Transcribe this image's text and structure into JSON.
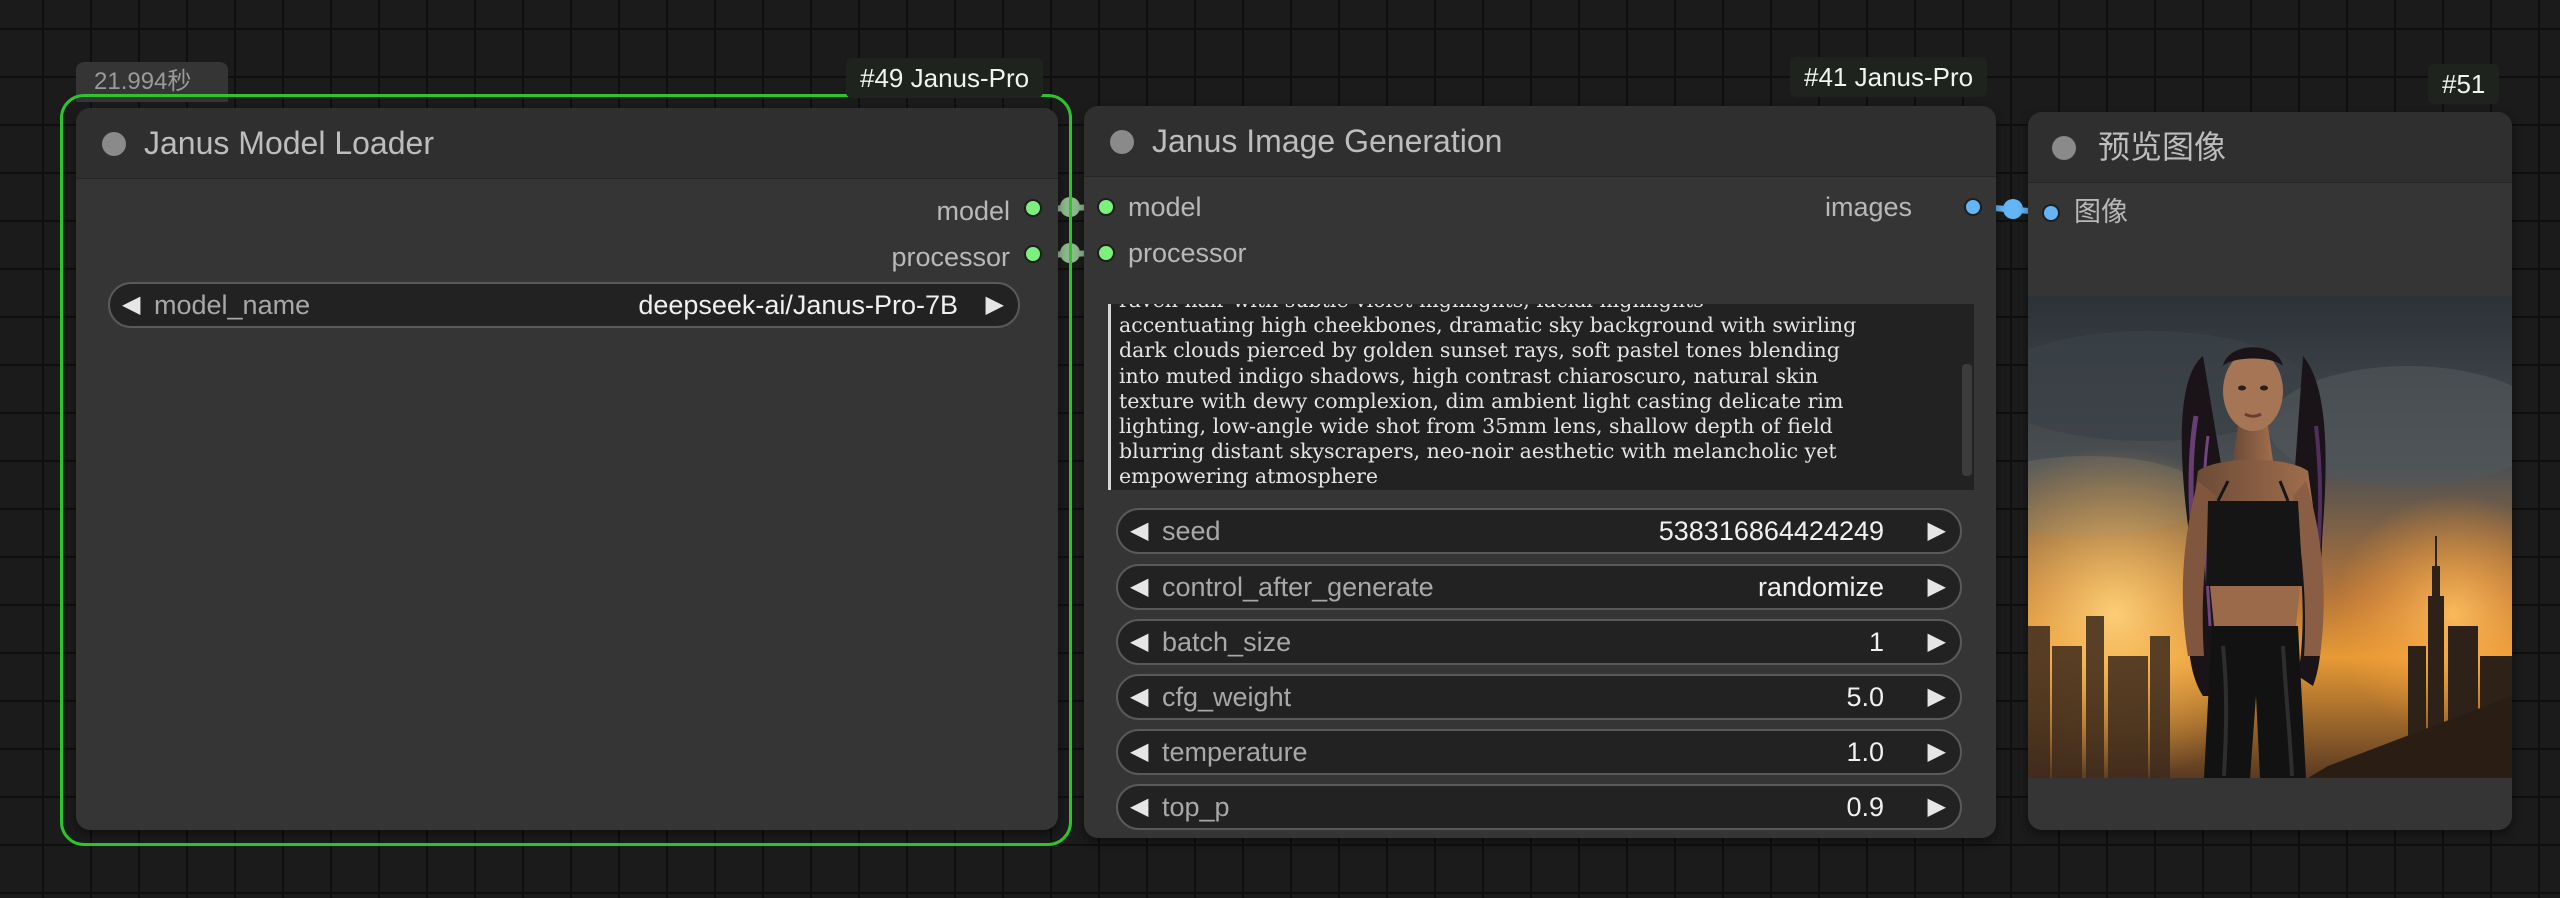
{
  "timing_badge": "21.994秒",
  "tags": {
    "node_49": "#49 Janus-Pro",
    "node_41": "#41 Janus-Pro",
    "node_51": "#51"
  },
  "model_loader": {
    "title": "Janus Model Loader",
    "outputs": [
      "model",
      "processor"
    ],
    "widget": {
      "label": "model_name",
      "value": "deepseek-ai/Janus-Pro-7B"
    }
  },
  "image_generation": {
    "title": "Janus Image Generation",
    "inputs": [
      "model",
      "processor"
    ],
    "output": "images",
    "prompt": "raven hair with subtle violet highlights, facial highlights\naccentuating high cheekbones, dramatic sky background with swirling\ndark clouds pierced by golden sunset rays, soft pastel tones blending\ninto muted indigo shadows, high contrast chiaroscuro, natural skin\ntexture with dewy complexion, dim ambient light casting delicate rim\nlighting, low-angle wide shot from 35mm lens, shallow depth of field\nblurring distant skyscrapers, neo-noir aesthetic with melancholic yet\nempowering atmosphere",
    "widgets": [
      {
        "label": "seed",
        "value": "538316864424249"
      },
      {
        "label": "control_after_generate",
        "value": "randomize"
      },
      {
        "label": "batch_size",
        "value": "1"
      },
      {
        "label": "cfg_weight",
        "value": "5.0"
      },
      {
        "label": "temperature",
        "value": "1.0"
      },
      {
        "label": "top_p",
        "value": "0.9"
      }
    ]
  },
  "preview": {
    "title": "预览图像",
    "input": "图像"
  },
  "icons": {
    "decrement": "◀",
    "increment": "▶"
  },
  "colors": {
    "selection": "#2dc42d",
    "model_link": "#7cf07c",
    "image_link": "#64b5f6"
  }
}
